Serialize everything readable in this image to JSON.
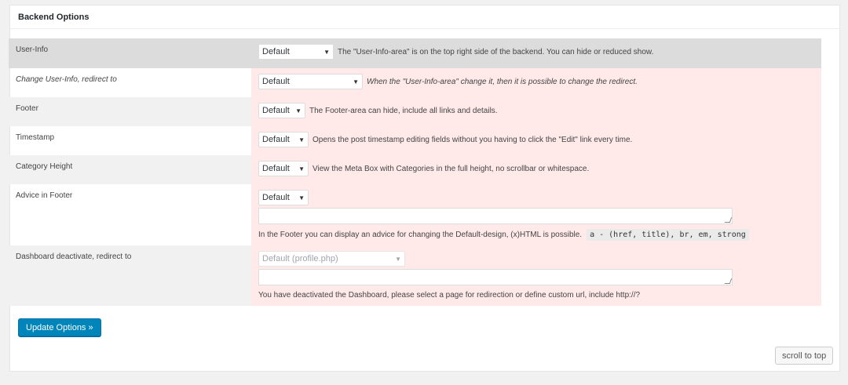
{
  "panel": {
    "title": "Backend Options"
  },
  "rows": [
    {
      "label": "User-Info",
      "select": "Default",
      "description": "The \"User-Info-area\" is on the top right side of the backend. You can hide or reduced show."
    },
    {
      "label": "Change User-Info, redirect to",
      "select": "Default",
      "description": "When the \"User-Info-area\" change it, then it is possible to change the redirect."
    },
    {
      "label": "Footer",
      "select": "Default",
      "description": "The Footer-area can hide, include all links and details."
    },
    {
      "label": "Timestamp",
      "select": "Default",
      "description": "Opens the post timestamp editing fields without you having to click the \"Edit\" link every time."
    },
    {
      "label": "Category Height",
      "select": "Default",
      "description": "View the Meta Box with Categories in the full height, no scrollbar or whitespace."
    },
    {
      "label": "Advice in Footer",
      "select": "Default",
      "textarea": "",
      "description": "In the Footer you can display an advice for changing the Default-design, (x)HTML is possible.",
      "code": "a - (href, title), br, em, strong"
    },
    {
      "label": "Dashboard deactivate, redirect to",
      "select": "Default (profile.php)",
      "textarea": "",
      "description": "You have deactivated the Dashboard, please select a page for redirection or define custom url, include http://?"
    }
  ],
  "buttons": {
    "update": "Update Options »",
    "scroll_top": "scroll to top"
  },
  "colors": {
    "accent": "#0085ba",
    "field_bg": "#ffe9e9",
    "first_row_bg": "#dcdcdc"
  }
}
